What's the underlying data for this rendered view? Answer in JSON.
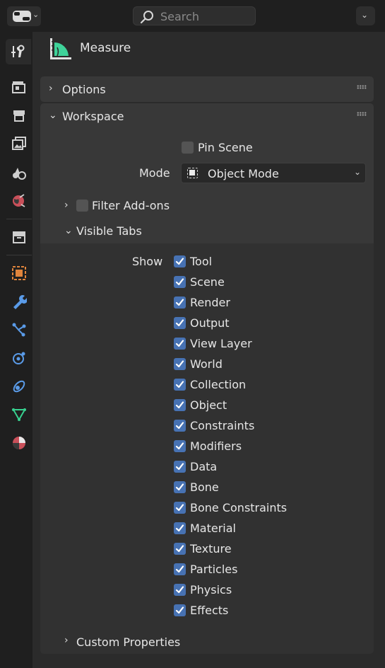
{
  "header": {
    "search_placeholder": "Search"
  },
  "tool": {
    "name": "Measure"
  },
  "panels": {
    "options": {
      "label": "Options"
    },
    "workspace": {
      "label": "Workspace",
      "pin_scene_label": "Pin Scene",
      "pin_scene_checked": false,
      "mode_label": "Mode",
      "mode_value": "Object Mode",
      "filter_addons_label": "Filter Add-ons",
      "filter_addons_checked": false,
      "visible_tabs": {
        "label": "Visible Tabs",
        "show_label": "Show",
        "items": [
          {
            "label": "Tool",
            "checked": true
          },
          {
            "label": "Scene",
            "checked": true
          },
          {
            "label": "Render",
            "checked": true
          },
          {
            "label": "Output",
            "checked": true
          },
          {
            "label": "View Layer",
            "checked": true
          },
          {
            "label": "World",
            "checked": true
          },
          {
            "label": "Collection",
            "checked": true
          },
          {
            "label": "Object",
            "checked": true
          },
          {
            "label": "Constraints",
            "checked": true
          },
          {
            "label": "Modifiers",
            "checked": true
          },
          {
            "label": "Data",
            "checked": true
          },
          {
            "label": "Bone",
            "checked": true
          },
          {
            "label": "Bone Constraints",
            "checked": true
          },
          {
            "label": "Material",
            "checked": true
          },
          {
            "label": "Texture",
            "checked": true
          },
          {
            "label": "Particles",
            "checked": true
          },
          {
            "label": "Physics",
            "checked": true
          },
          {
            "label": "Effects",
            "checked": true
          }
        ]
      }
    },
    "custom_properties": {
      "label": "Custom Properties"
    }
  },
  "tabs": [
    {
      "name": "tool-tab",
      "icon": "tool-icon",
      "active": true
    },
    {
      "name": "render-tab",
      "icon": "render-icon",
      "active": false
    },
    {
      "name": "output-tab",
      "icon": "output-icon",
      "active": false
    },
    {
      "name": "view-layer-tab",
      "icon": "view-layer-icon",
      "active": false
    },
    {
      "name": "scene-tab",
      "icon": "scene-icon",
      "active": false
    },
    {
      "name": "world-tab",
      "icon": "world-icon",
      "active": false
    },
    {
      "name": "collection-tab",
      "icon": "collection-icon",
      "active": false
    },
    {
      "name": "object-tab",
      "icon": "object-icon",
      "active": false
    },
    {
      "name": "modifiers-tab",
      "icon": "modifier-wrench-icon",
      "active": false
    },
    {
      "name": "particles-tab",
      "icon": "particles-icon",
      "active": false
    },
    {
      "name": "physics-tab",
      "icon": "physics-icon",
      "active": false
    },
    {
      "name": "constraints-tab",
      "icon": "object-constraint-icon",
      "active": false
    },
    {
      "name": "data-tab",
      "icon": "mesh-data-icon",
      "active": false
    },
    {
      "name": "material-tab",
      "icon": "material-icon",
      "active": false
    }
  ],
  "colors": {
    "accent": "#4772b3",
    "object_orange": "#e0843c",
    "modifier_blue": "#5a9be8",
    "data_green": "#37d08f",
    "world_red": "#c9505a",
    "measure_green": "#3fd39a"
  }
}
